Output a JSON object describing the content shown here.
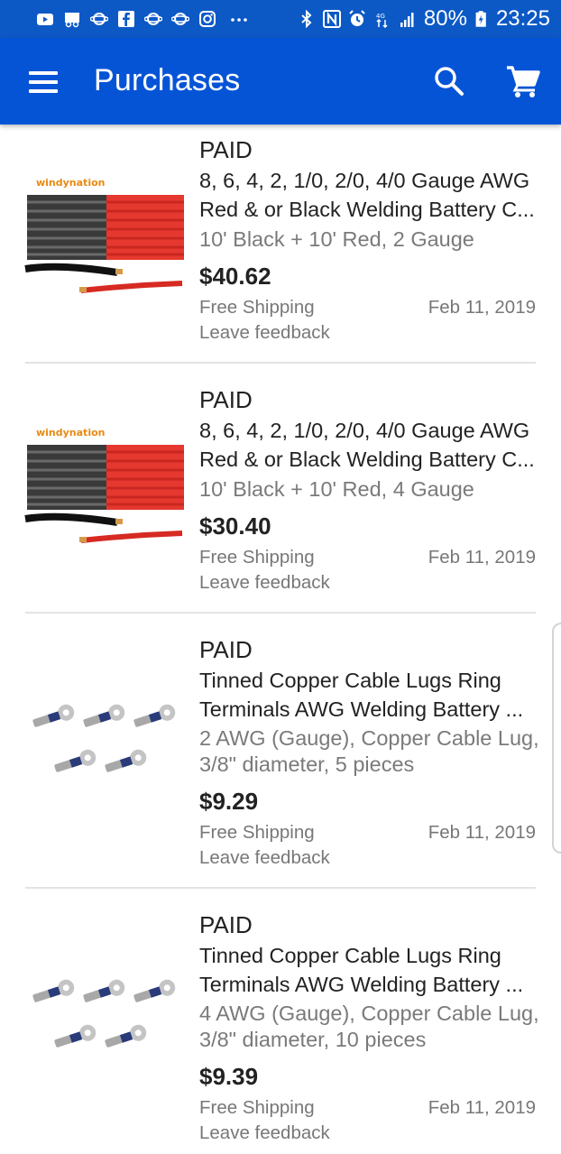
{
  "status_bar": {
    "battery": "80%",
    "time": "23:25",
    "icons": [
      "youtube-icon",
      "voicemail-icon",
      "planet-icon",
      "facebook-icon",
      "planet-icon",
      "planet-icon",
      "instagram-icon",
      "more-icon",
      "bluetooth-icon",
      "nfc-icon",
      "alarm-icon",
      "data-icon",
      "signal-icon",
      "battery-icon"
    ]
  },
  "header": {
    "title": "Purchases",
    "background": "#0654d6"
  },
  "orders": [
    {
      "status": "PAID",
      "title_line1": "8, 6, 4, 2, 1/0, 2/0, 4/0 Gauge AWG",
      "title_line2": "Red & or Black Welding Battery C...",
      "variant": "10' Black + 10' Red, 2 Gauge",
      "price": "$40.62",
      "shipping": "Free Shipping",
      "date": "Feb 11, 2019",
      "feedback": "Leave feedback",
      "thumb_brand": "windynation"
    },
    {
      "status": "PAID",
      "title_line1": "8, 6, 4, 2, 1/0, 2/0, 4/0 Gauge AWG",
      "title_line2": "Red & or Black Welding Battery C...",
      "variant": "10' Black + 10' Red, 4 Gauge",
      "price": "$30.40",
      "shipping": "Free Shipping",
      "date": "Feb 11, 2019",
      "feedback": "Leave feedback",
      "thumb_brand": "windynation"
    },
    {
      "status": "PAID",
      "title_line1": "Tinned Copper Cable Lugs Ring",
      "title_line2": "Terminals AWG Welding Battery ...",
      "variant": "2 AWG (Gauge), Copper Cable Lug, 3/8\" diameter, 5 pieces",
      "price": "$9.29",
      "shipping": "Free Shipping",
      "date": "Feb 11, 2019",
      "feedback": "Leave feedback"
    },
    {
      "status": "PAID",
      "title_line1": "Tinned Copper Cable Lugs Ring",
      "title_line2": "Terminals AWG Welding Battery ...",
      "variant": "4 AWG (Gauge), Copper Cable Lug, 3/8\" diameter, 10 pieces",
      "price": "$9.39",
      "shipping": "Free Shipping",
      "date": "Feb 11, 2019",
      "feedback": "Leave feedback"
    }
  ]
}
